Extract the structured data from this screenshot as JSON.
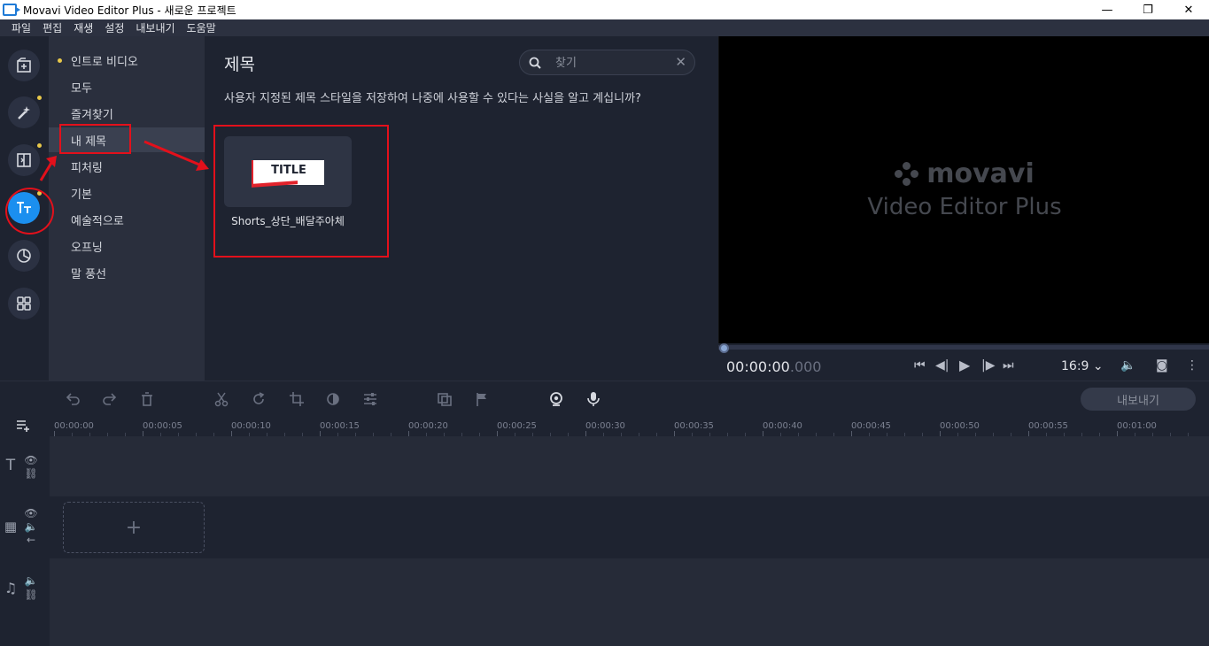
{
  "window": {
    "title": "Movavi Video Editor Plus - 새로운 프로젝트",
    "minimize": "—",
    "restore": "❐",
    "close": "✕"
  },
  "menu": [
    "파일",
    "편집",
    "재생",
    "설정",
    "내보내기",
    "도움말"
  ],
  "left_icons": [
    "import-icon",
    "magic-wand-icon",
    "transitions-icon",
    "titles-icon",
    "stickers-icon",
    "more-tools-icon"
  ],
  "categories": [
    {
      "label": "인트로 비디오"
    },
    {
      "label": "모두"
    },
    {
      "label": "즐겨찾기"
    },
    {
      "label": "내 제목"
    },
    {
      "label": "피처링"
    },
    {
      "label": "기본"
    },
    {
      "label": "예술적으로"
    },
    {
      "label": "오프닝"
    },
    {
      "label": "말 풍선"
    }
  ],
  "content": {
    "heading": "제목",
    "search_placeholder": "찾기",
    "tip": "사용자 지정된 제목 스타일을 저장하여 나중에 사용할 수 있다는 사실을 알고 계십니까?",
    "thumbnail_text": "TITLE",
    "thumbnail_label": "Shorts_상단_배달주아체"
  },
  "preview": {
    "brand": "movavi",
    "product": "Video Editor Plus",
    "timecode_main": "00:00:00",
    "timecode_ms": ".000",
    "aspect_ratio": "16:9"
  },
  "timeline": {
    "export_label": "내보내기",
    "ruler": [
      "00:00:00",
      "00:00:05",
      "00:00:10",
      "00:00:15",
      "00:00:20",
      "00:00:25",
      "00:00:30",
      "00:00:35",
      "00:00:40",
      "00:00:45",
      "00:00:50",
      "00:00:55",
      "00:01:00"
    ],
    "add_media": "+"
  },
  "colors": {
    "accent": "#1b8fef",
    "annotation": "#e3101b",
    "dot": "#e8c84a"
  }
}
